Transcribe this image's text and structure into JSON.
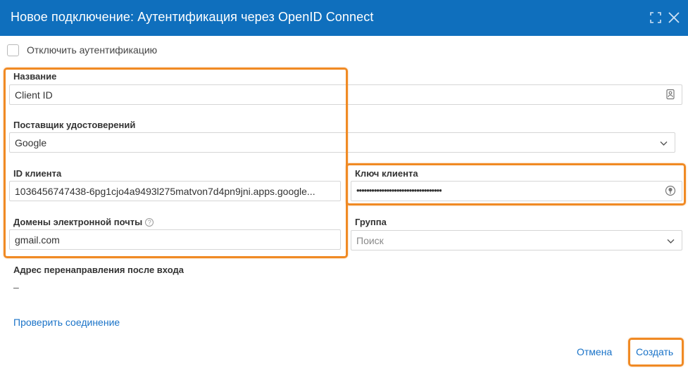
{
  "dialog": {
    "title": "Новое подключение: Аутентификация через OpenID Connect",
    "maximize_icon": "maximize-icon",
    "close_icon": "close-icon"
  },
  "disable_auth": {
    "label": "Отключить аутентификацию",
    "checked": false
  },
  "fields": {
    "name": {
      "label": "Название",
      "value": "Client ID",
      "icon": "contact-card-icon"
    },
    "provider": {
      "label": "Поставщик удостоверений",
      "value": "Google",
      "icon": "chevron-down-icon"
    },
    "client_id": {
      "label": "ID клиента",
      "value": "1036456747438-6pg1cjo4a9493l275matvon7d4pn9jni.apps.google..."
    },
    "client_key": {
      "label": "Ключ клиента",
      "value": "••••••••••••••••••••••••••••••••••",
      "icon": "reveal-password-icon"
    },
    "email_domains": {
      "label": "Домены электронной почты",
      "value": "gmail.com",
      "help_icon": "help-icon",
      "help_glyph": "?"
    },
    "group": {
      "label": "Группа",
      "placeholder": "Поиск",
      "icon": "chevron-down-icon"
    },
    "redirect": {
      "label": "Адрес перенаправления после входа",
      "value": "–"
    }
  },
  "actions": {
    "test_connection": "Проверить соединение",
    "cancel": "Отмена",
    "create": "Создать"
  },
  "colors": {
    "title_bar": "#0f6fbd",
    "highlight": "#f08a24",
    "link": "#1a73c8"
  }
}
